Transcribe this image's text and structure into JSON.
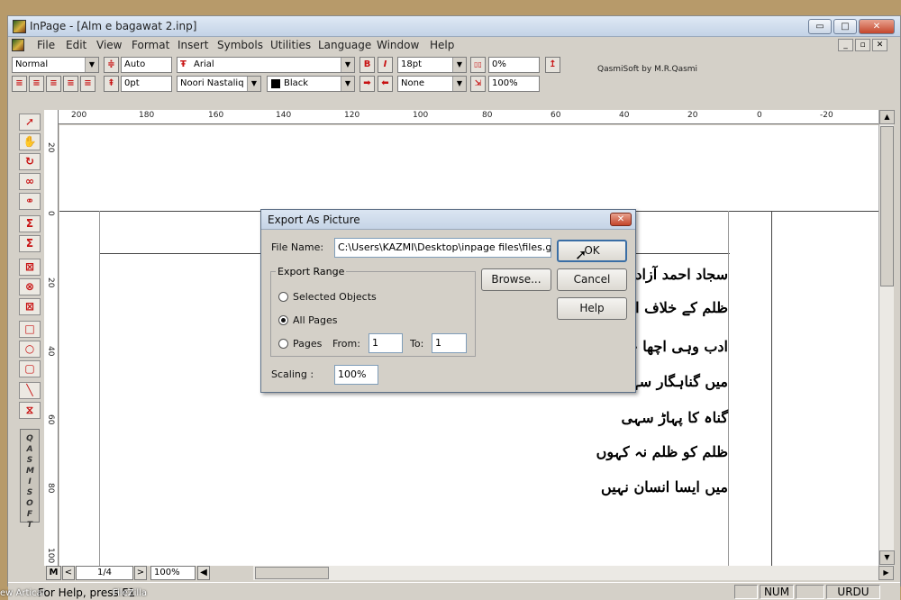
{
  "window": {
    "title": "InPage - [Alm e bagawat 2.inp]",
    "controls": {
      "minimize": "▭",
      "maximize": "□",
      "close": "✕"
    }
  },
  "menu": [
    "File",
    "Edit",
    "View",
    "Format",
    "Insert",
    "Symbols",
    "Utilities",
    "Language",
    "Window",
    "Help"
  ],
  "toolbar": {
    "style": "Normal",
    "leading": "Auto",
    "font": "Arial",
    "size": "18pt",
    "tracking": "0%",
    "indent": "0pt",
    "urdu_font": "Noori Nastaliq",
    "color": "Black",
    "shade": "None",
    "scale": "100%",
    "bold_label": "B",
    "italic_label": "I",
    "brand": "QasmiSoft by M.R.Qasmi"
  },
  "ruler": {
    "h_ticks": [
      "200",
      "180",
      "160",
      "140",
      "120",
      "100",
      "80",
      "60",
      "40",
      "20",
      "0",
      "-20"
    ],
    "v_ticks": [
      "20",
      "0",
      "20",
      "40",
      "60",
      "80",
      "100"
    ]
  },
  "document_text": [
    "سجاد احمد آزاد",
    "ظلم کے خلاف امن",
    "ادب وہی اچھا جس",
    "میں گناہگار سہی",
    "گناہ کا پہاڑ سہی",
    "ظلم کو ظلم نہ کہوں",
    "میں ایسا انسان نہیں"
  ],
  "toolbox_label": "QASMISOFT",
  "bottom": {
    "page_indicator": "1/4",
    "zoom": "100%",
    "master": "M"
  },
  "status": {
    "help": "For Help, press F1",
    "num": "NUM",
    "lang": "URDU"
  },
  "desktop_labels": [
    "ew Artical",
    "FileZilla"
  ],
  "dialog": {
    "title": "Export As Picture",
    "file_name_label": "File Name:",
    "file_name_value": "C:\\Users\\KAZMI\\Desktop\\inpage files\\files.gif",
    "export_range_label": "Export Range",
    "options": [
      "Selected Objects",
      "All Pages",
      "Pages"
    ],
    "selected_option": "All Pages",
    "from_label": "From:",
    "from_value": "1",
    "to_label": "To:",
    "to_value": "1",
    "scaling_label": "Scaling :",
    "scaling_value": "100%",
    "ok_label": "OK",
    "browse_label": "Browse...",
    "cancel_label": "Cancel",
    "help_label": "Help"
  }
}
